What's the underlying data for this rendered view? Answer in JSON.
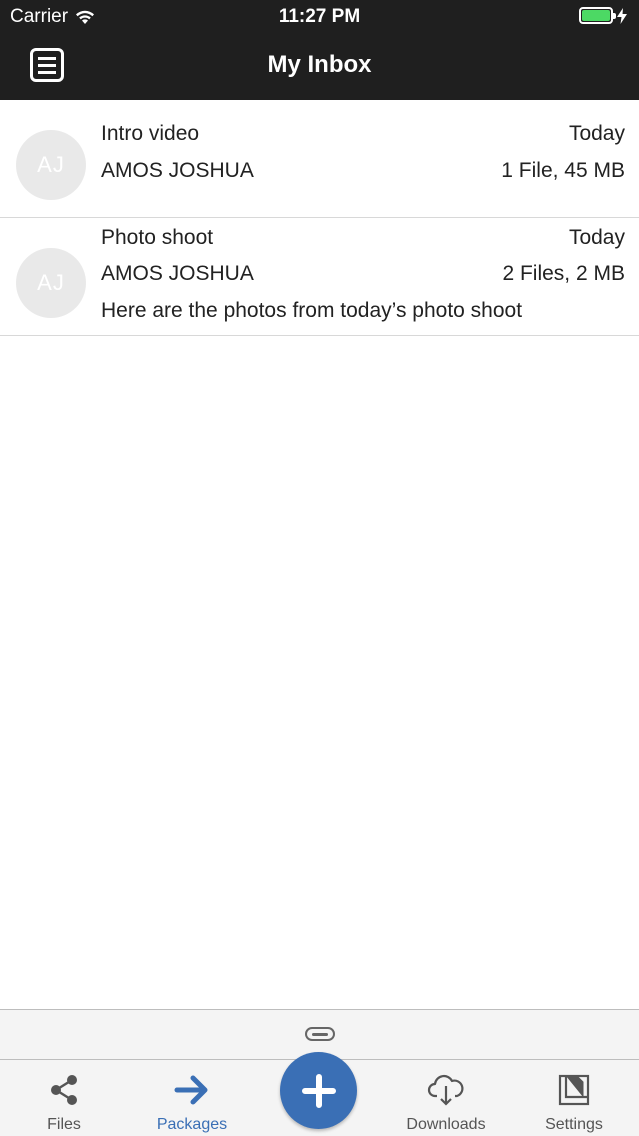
{
  "status_bar": {
    "carrier": "Carrier",
    "time": "11:27 PM",
    "battery_level": 1.0,
    "battery_color": "#4cd964"
  },
  "nav": {
    "title": "My Inbox",
    "menu_icon": "menu-icon"
  },
  "inbox": [
    {
      "avatar": "AJ",
      "title": "Intro video",
      "date": "Today",
      "sender": "AMOS JOSHUA",
      "size": "1 File, 45 MB",
      "message": ""
    },
    {
      "avatar": "AJ",
      "title": "Photo shoot",
      "date": "Today",
      "sender": "AMOS JOSHUA",
      "size": "2 Files, 2 MB",
      "message": "Here are the photos from today’s photo shoot"
    }
  ],
  "tabs": [
    {
      "label": "Files",
      "icon": "share-icon"
    },
    {
      "label": "Packages",
      "icon": "arrow-right-icon",
      "active": true
    },
    {
      "label": "Downloads",
      "icon": "cloud-download-icon"
    },
    {
      "label": "Settings",
      "icon": "settings-document-icon"
    }
  ],
  "fab": {
    "icon": "plus-icon"
  },
  "colors": {
    "header_bg": "#1f1f1f",
    "accent": "#3a6fb5",
    "avatar_bg": "#e9e9e9",
    "tab_bar_bg": "#f4f4f4"
  }
}
